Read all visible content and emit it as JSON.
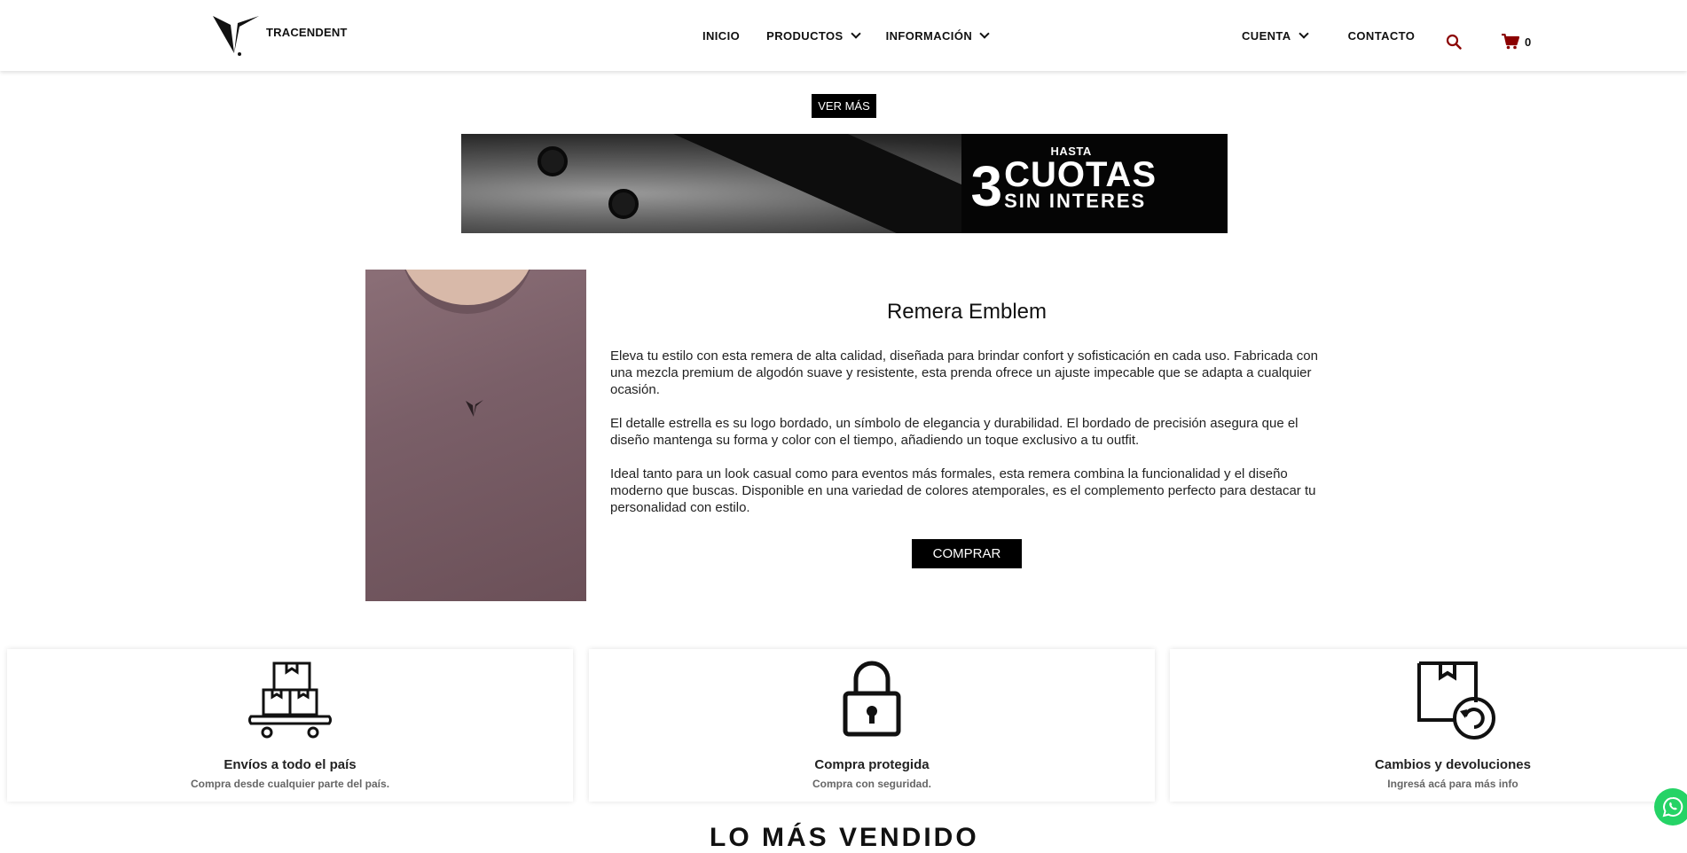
{
  "header": {
    "logo_text": "TRACENDENT",
    "nav": {
      "inicio": "INICIO",
      "productos": "PRODUCTOS",
      "informacion": "INFORMACIÓN",
      "cuenta": "CUENTA",
      "contacto": "CONTACTO"
    },
    "cart_count": "0",
    "accent_color": "#8b0000"
  },
  "promo": {
    "ver_mas": "VER MÁS",
    "banner": {
      "hasta": "HASTA",
      "number": "3",
      "cuotas": "CUOTAS",
      "sin_interes": "SIN INTERES"
    }
  },
  "product": {
    "title": "Remera Emblem",
    "paragraphs": [
      "Eleva tu estilo con esta remera de alta calidad, diseñada para brindar confort y sofisticación en cada uso. Fabricada con una mezcla premium de algodón suave y resistente, esta prenda ofrece un ajuste impecable que se adapta a cualquier ocasión.",
      "El detalle estrella es su logo bordado, un símbolo de elegancia y durabilidad. El bordado de precisión asegura que el diseño mantenga su forma y color con el tiempo, añadiendo un toque exclusivo a tu outfit.",
      "Ideal tanto para un look casual como para eventos más formales, esta remera combina la funcionalidad y el diseño moderno que buscas. Disponible en una variedad de colores atemporales, es el complemento perfecto para destacar tu personalidad con estilo."
    ],
    "buy_label": "COMPRAR"
  },
  "features": [
    {
      "icon": "shipping-cart-icon",
      "title": "Envíos a todo el país",
      "subtitle": "Compra desde cualquier parte del país."
    },
    {
      "icon": "lock-icon",
      "title": "Compra protegida",
      "subtitle": "Compra con seguridad."
    },
    {
      "icon": "return-box-icon",
      "title": "Cambios y devoluciones",
      "subtitle": "Ingresá acá para más info"
    }
  ],
  "section_heading": "LO MÁS VENDIDO"
}
